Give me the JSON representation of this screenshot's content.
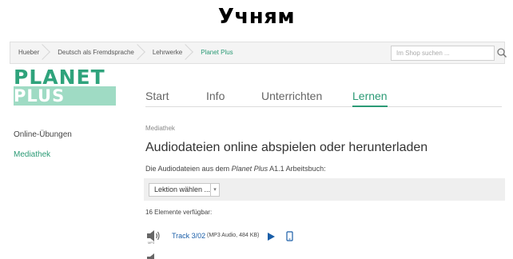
{
  "banner": {
    "title": "Учням"
  },
  "breadcrumb": [
    "Hueber",
    "Deutsch als Fremdsprache",
    "Lehrwerke",
    "Planet Plus"
  ],
  "search": {
    "placeholder": "Im Shop suchen ..."
  },
  "logo": {
    "top": "PLANET",
    "bottom": "PLUS"
  },
  "tabs": [
    "Start",
    "Info",
    "Unterrichten",
    "Lernen"
  ],
  "active_tab": "Lernen",
  "sidebar": [
    {
      "label": "Online-Übungen",
      "active": false
    },
    {
      "label": "Mediathek",
      "active": true
    }
  ],
  "main": {
    "section_label": "Mediathek",
    "heading": "Audiodateien online abspielen oder herunterladen",
    "intro_before": "Die Audiodateien aus dem ",
    "intro_title": "Planet Plus",
    "intro_after": " A1.1 Arbeitsbuch:",
    "select_value": "Lektion wählen ...",
    "count_text": "16 Elemente verfügbar:",
    "tracks": [
      {
        "icon_label": "MP3",
        "title": "Track 3/02",
        "meta": "(MP3 Audio, 484 KB)"
      }
    ]
  },
  "colors": {
    "accent": "#2b9a75",
    "logo_band": "#9fdbc4",
    "link": "#1a5ea8"
  },
  "icons": [
    "search-icon",
    "speaker-icon",
    "play-icon",
    "device-icon",
    "chevron-down-icon"
  ]
}
